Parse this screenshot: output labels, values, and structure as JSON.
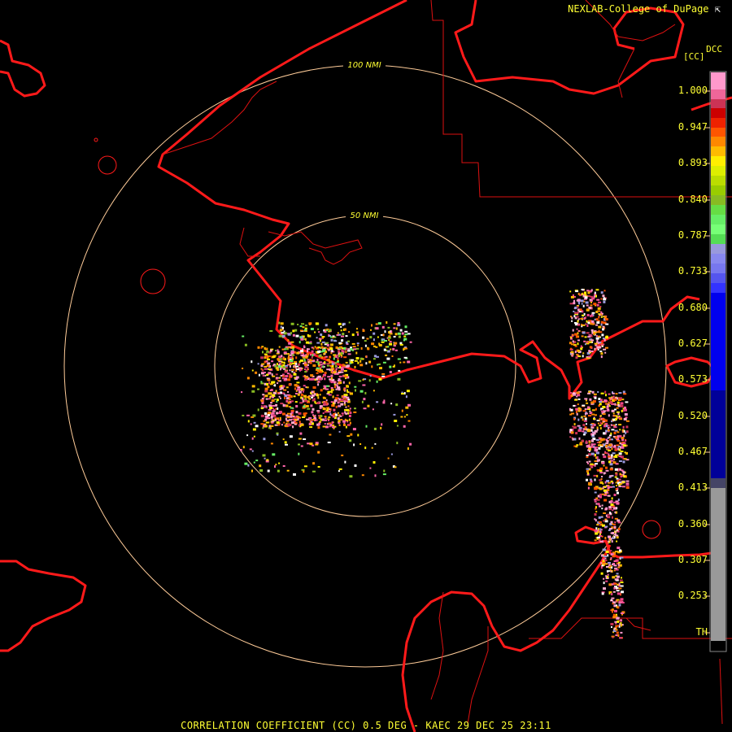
{
  "credit": "NEXLAB-College of DuPage",
  "credit_flag": "⇱",
  "product": "DCC",
  "unit": "[CC]",
  "range_rings": [
    {
      "label": "100 NMI"
    },
    {
      "label": "50 NMI"
    }
  ],
  "colorbar": {
    "labels": [
      "1.000",
      "0.947",
      "0.893",
      "0.840",
      "0.787",
      "0.733",
      "0.680",
      "0.627",
      "0.573",
      "0.520",
      "0.467",
      "0.413",
      "0.360",
      "0.307",
      "0.253",
      "TH"
    ]
  },
  "bottom_title": "CORRELATION COEFFICIENT (CC) 0.5 DEG - KAEC 29 DEC 25 23:11",
  "colors": {
    "coast": "#ff1a1a",
    "ring": "#ffcc99",
    "text": "#ffff33"
  }
}
